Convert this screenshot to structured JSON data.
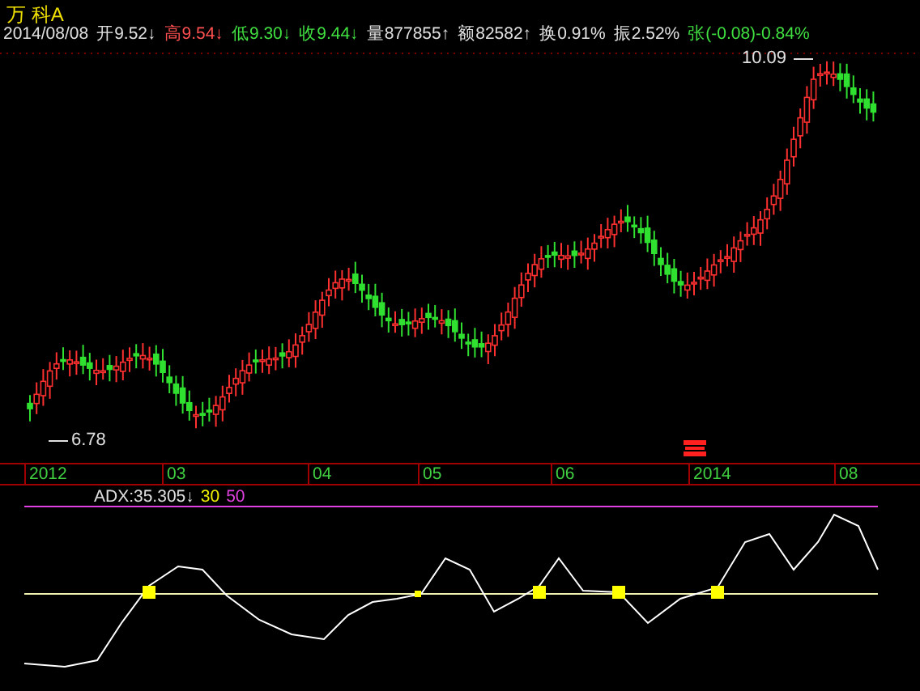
{
  "title": "万 科A",
  "quote": [
    {
      "text": "2014/08/08",
      "color": "#e0e0e0"
    },
    {
      "text": "开9.52↓",
      "color": "#e0e0e0"
    },
    {
      "text": "高9.54↓",
      "color": "#ff5050"
    },
    {
      "text": "低9.30↓",
      "color": "#40e040"
    },
    {
      "text": "收9.44↓",
      "color": "#40e040"
    },
    {
      "text": "量877855↑",
      "color": "#e0e0e0"
    },
    {
      "text": "额82582↑",
      "color": "#e0e0e0"
    },
    {
      "text": "换0.91%",
      "color": "#e0e0e0"
    },
    {
      "text": "振2.52%",
      "color": "#e0e0e0"
    },
    {
      "text": "张(-0.08)-0.84%",
      "color": "#40e040"
    }
  ],
  "price_labels": {
    "high": "10.09",
    "low": "6.78"
  },
  "axis_labels": [
    "2012",
    "03",
    "04",
    "05",
    "06",
    "2014",
    "08"
  ],
  "indicator": {
    "reading": "ADX:35.305↓",
    "line_low": "30",
    "line_high": "50"
  }
}
